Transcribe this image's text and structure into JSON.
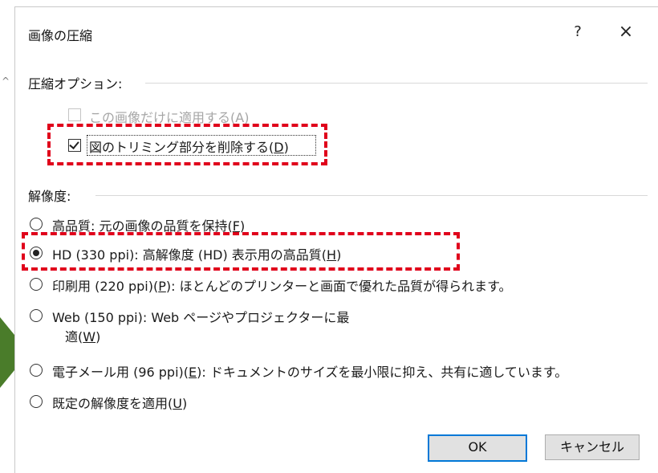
{
  "dialog": {
    "title": "画像の圧縮",
    "help_label": "?",
    "close_label": "×"
  },
  "compression": {
    "group_label": "圧縮オプション:",
    "apply_only_this": {
      "label": "この画像だけに適用する(A)",
      "checked": false,
      "disabled": true
    },
    "delete_cropped": {
      "label_pre": "図のトリミング部分を削除する(",
      "mnemonic": "D",
      "label_post": ")",
      "checked": true
    }
  },
  "resolution": {
    "group_label": "解像度:",
    "options": [
      {
        "label_pre": "高品質: 元の画像の品質を保持(",
        "mnemonic": "F",
        "label_post": ")",
        "selected": false
      },
      {
        "label_pre": "HD (330 ppi): 高解像度 (HD) 表示用の高品質(",
        "mnemonic": "H",
        "label_post": ")",
        "selected": true
      },
      {
        "label_pre": "印刷用 (220 ppi)(",
        "mnemonic": "P",
        "label_post": "): ほとんどのプリンターと画面で優れた品質が得られます。",
        "selected": false
      },
      {
        "label_line1": "Web (150 ppi): Web ページやプロジェクターに最",
        "label_pre": "適(",
        "mnemonic": "W",
        "label_post": ")",
        "selected": false
      },
      {
        "label_pre": "電子メール用 (96 ppi)(",
        "mnemonic": "E",
        "label_post": "): ドキュメントのサイズを最小限に抑え、共有に適しています。",
        "selected": false
      },
      {
        "label_pre": "既定の解像度を適用(",
        "mnemonic": "U",
        "label_post": ")",
        "selected": false
      }
    ]
  },
  "buttons": {
    "ok": "OK",
    "cancel": "キャンセル"
  },
  "colors": {
    "annotation_red": "#e0001b",
    "accent_blue": "#0078d7",
    "arrow_green": "#4a7c2a"
  }
}
